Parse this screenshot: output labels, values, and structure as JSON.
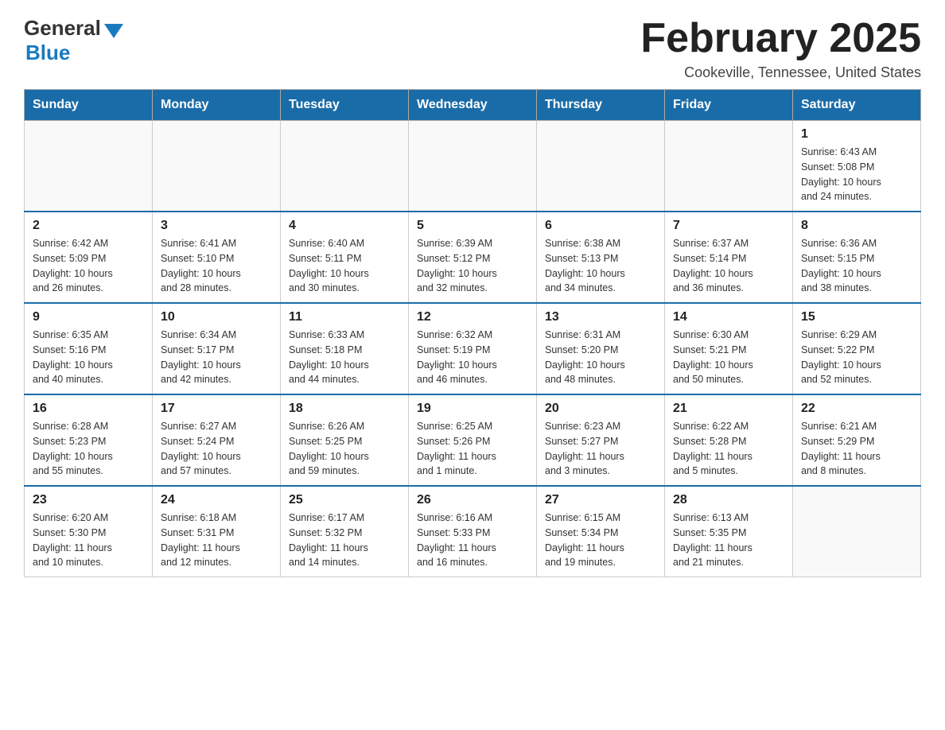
{
  "header": {
    "logo_general": "General",
    "logo_blue": "Blue",
    "month_title": "February 2025",
    "location": "Cookeville, Tennessee, United States"
  },
  "weekdays": [
    "Sunday",
    "Monday",
    "Tuesday",
    "Wednesday",
    "Thursday",
    "Friday",
    "Saturday"
  ],
  "weeks": [
    [
      {
        "day": "",
        "info": ""
      },
      {
        "day": "",
        "info": ""
      },
      {
        "day": "",
        "info": ""
      },
      {
        "day": "",
        "info": ""
      },
      {
        "day": "",
        "info": ""
      },
      {
        "day": "",
        "info": ""
      },
      {
        "day": "1",
        "info": "Sunrise: 6:43 AM\nSunset: 5:08 PM\nDaylight: 10 hours\nand 24 minutes."
      }
    ],
    [
      {
        "day": "2",
        "info": "Sunrise: 6:42 AM\nSunset: 5:09 PM\nDaylight: 10 hours\nand 26 minutes."
      },
      {
        "day": "3",
        "info": "Sunrise: 6:41 AM\nSunset: 5:10 PM\nDaylight: 10 hours\nand 28 minutes."
      },
      {
        "day": "4",
        "info": "Sunrise: 6:40 AM\nSunset: 5:11 PM\nDaylight: 10 hours\nand 30 minutes."
      },
      {
        "day": "5",
        "info": "Sunrise: 6:39 AM\nSunset: 5:12 PM\nDaylight: 10 hours\nand 32 minutes."
      },
      {
        "day": "6",
        "info": "Sunrise: 6:38 AM\nSunset: 5:13 PM\nDaylight: 10 hours\nand 34 minutes."
      },
      {
        "day": "7",
        "info": "Sunrise: 6:37 AM\nSunset: 5:14 PM\nDaylight: 10 hours\nand 36 minutes."
      },
      {
        "day": "8",
        "info": "Sunrise: 6:36 AM\nSunset: 5:15 PM\nDaylight: 10 hours\nand 38 minutes."
      }
    ],
    [
      {
        "day": "9",
        "info": "Sunrise: 6:35 AM\nSunset: 5:16 PM\nDaylight: 10 hours\nand 40 minutes."
      },
      {
        "day": "10",
        "info": "Sunrise: 6:34 AM\nSunset: 5:17 PM\nDaylight: 10 hours\nand 42 minutes."
      },
      {
        "day": "11",
        "info": "Sunrise: 6:33 AM\nSunset: 5:18 PM\nDaylight: 10 hours\nand 44 minutes."
      },
      {
        "day": "12",
        "info": "Sunrise: 6:32 AM\nSunset: 5:19 PM\nDaylight: 10 hours\nand 46 minutes."
      },
      {
        "day": "13",
        "info": "Sunrise: 6:31 AM\nSunset: 5:20 PM\nDaylight: 10 hours\nand 48 minutes."
      },
      {
        "day": "14",
        "info": "Sunrise: 6:30 AM\nSunset: 5:21 PM\nDaylight: 10 hours\nand 50 minutes."
      },
      {
        "day": "15",
        "info": "Sunrise: 6:29 AM\nSunset: 5:22 PM\nDaylight: 10 hours\nand 52 minutes."
      }
    ],
    [
      {
        "day": "16",
        "info": "Sunrise: 6:28 AM\nSunset: 5:23 PM\nDaylight: 10 hours\nand 55 minutes."
      },
      {
        "day": "17",
        "info": "Sunrise: 6:27 AM\nSunset: 5:24 PM\nDaylight: 10 hours\nand 57 minutes."
      },
      {
        "day": "18",
        "info": "Sunrise: 6:26 AM\nSunset: 5:25 PM\nDaylight: 10 hours\nand 59 minutes."
      },
      {
        "day": "19",
        "info": "Sunrise: 6:25 AM\nSunset: 5:26 PM\nDaylight: 11 hours\nand 1 minute."
      },
      {
        "day": "20",
        "info": "Sunrise: 6:23 AM\nSunset: 5:27 PM\nDaylight: 11 hours\nand 3 minutes."
      },
      {
        "day": "21",
        "info": "Sunrise: 6:22 AM\nSunset: 5:28 PM\nDaylight: 11 hours\nand 5 minutes."
      },
      {
        "day": "22",
        "info": "Sunrise: 6:21 AM\nSunset: 5:29 PM\nDaylight: 11 hours\nand 8 minutes."
      }
    ],
    [
      {
        "day": "23",
        "info": "Sunrise: 6:20 AM\nSunset: 5:30 PM\nDaylight: 11 hours\nand 10 minutes."
      },
      {
        "day": "24",
        "info": "Sunrise: 6:18 AM\nSunset: 5:31 PM\nDaylight: 11 hours\nand 12 minutes."
      },
      {
        "day": "25",
        "info": "Sunrise: 6:17 AM\nSunset: 5:32 PM\nDaylight: 11 hours\nand 14 minutes."
      },
      {
        "day": "26",
        "info": "Sunrise: 6:16 AM\nSunset: 5:33 PM\nDaylight: 11 hours\nand 16 minutes."
      },
      {
        "day": "27",
        "info": "Sunrise: 6:15 AM\nSunset: 5:34 PM\nDaylight: 11 hours\nand 19 minutes."
      },
      {
        "day": "28",
        "info": "Sunrise: 6:13 AM\nSunset: 5:35 PM\nDaylight: 11 hours\nand 21 minutes."
      },
      {
        "day": "",
        "info": ""
      }
    ]
  ]
}
